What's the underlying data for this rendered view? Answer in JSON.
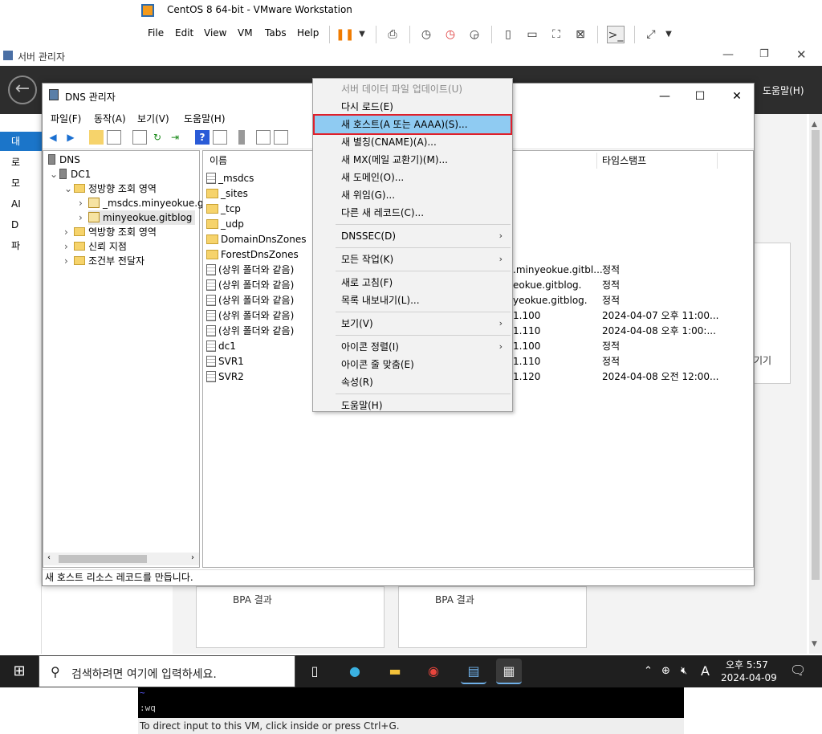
{
  "vm": {
    "title": "CentOS 8 64-bit - VMware Workstation",
    "menu": [
      "File",
      "Edit",
      "View",
      "VM",
      "Tabs",
      "Help"
    ],
    "status": "To direct input to this VM, click inside or press Ctrl+G.",
    "console_line1": "~",
    "console_line2": ":wq"
  },
  "server_manager": {
    "title": "서버 관리자",
    "help": "도움말(H)",
    "left_items": [
      "대",
      "로",
      "모",
      "AI",
      "D",
      "파"
    ],
    "bpa_label": "BPA 결과",
    "side_text": "기기"
  },
  "dns": {
    "title": "DNS 관리자",
    "menu": [
      "파일(F)",
      "동작(A)",
      "보기(V)",
      "도움말(H)"
    ],
    "status": "새 호스트 리소스 레코드를 만듭니다.",
    "tree": [
      {
        "label": "DNS",
        "kind": "root"
      },
      {
        "label": "DC1",
        "kind": "server"
      },
      {
        "label": "정방향 조회 영역",
        "kind": "folder"
      },
      {
        "label": "_msdcs.minyeokue.g",
        "kind": "zone"
      },
      {
        "label": "minyeokue.gitblog",
        "kind": "zone"
      },
      {
        "label": "역방향 조회 영역",
        "kind": "folder"
      },
      {
        "label": "신뢰 지점",
        "kind": "folder"
      },
      {
        "label": "조건부 전달자",
        "kind": "folder"
      }
    ],
    "columns": {
      "name": "이름",
      "timestamp": "타임스탬프"
    },
    "rows": [
      {
        "name": "_msdcs",
        "icon": "doc",
        "data": "",
        "ts": ""
      },
      {
        "name": "_sites",
        "icon": "folder",
        "data": "",
        "ts": ""
      },
      {
        "name": "_tcp",
        "icon": "folder",
        "data": "",
        "ts": ""
      },
      {
        "name": "_udp",
        "icon": "folder",
        "data": "",
        "ts": ""
      },
      {
        "name": "DomainDnsZones",
        "icon": "folder",
        "data": "",
        "ts": ""
      },
      {
        "name": "ForestDnsZones",
        "icon": "folder",
        "data": "",
        "ts": ""
      },
      {
        "name": "(상위 폴더와 같음)",
        "icon": "doc",
        "data": ".minyeokue.gitbl...",
        "ts": "정적"
      },
      {
        "name": "(상위 폴더와 같음)",
        "icon": "doc",
        "data": "eokue.gitblog.",
        "ts": "정적"
      },
      {
        "name": "(상위 폴더와 같음)",
        "icon": "doc",
        "data": "yeokue.gitblog.",
        "ts": "정적"
      },
      {
        "name": "(상위 폴더와 같음)",
        "icon": "doc",
        "data": "1.100",
        "ts": "2024-04-07 오후 11:00..."
      },
      {
        "name": "(상위 폴더와 같음)",
        "icon": "doc",
        "data": "1.110",
        "ts": "2024-04-08 오후 1:00:..."
      },
      {
        "name": "dc1",
        "icon": "doc",
        "data": "1.100",
        "ts": "정적"
      },
      {
        "name": "SVR1",
        "icon": "doc",
        "data": "1.110",
        "ts": "정적"
      },
      {
        "name": "SVR2",
        "icon": "doc",
        "data": "1.120",
        "ts": "2024-04-08 오전 12:00..."
      }
    ]
  },
  "context_menu": {
    "items": [
      {
        "label": "서버 데이터 파일 업데이트(U)",
        "disabled": true
      },
      {
        "label": "다시 로드(E)"
      },
      {
        "label": "새 호스트(A 또는 AAAA)(S)...",
        "highlight": true
      },
      {
        "label": "새 별칭(CNAME)(A)..."
      },
      {
        "label": "새 MX(메일 교환기)(M)..."
      },
      {
        "label": "새 도메인(O)..."
      },
      {
        "label": "새 위임(G)..."
      },
      {
        "label": "다른 새 레코드(C)..."
      },
      {
        "label": "DNSSEC(D)",
        "sub": true
      },
      {
        "label": "모든 작업(K)",
        "sub": true
      },
      {
        "label": "새로 고침(F)"
      },
      {
        "label": "목록 내보내기(L)..."
      },
      {
        "label": "보기(V)",
        "sub": true
      },
      {
        "label": "아이콘 정렬(I)",
        "sub": true
      },
      {
        "label": "아이콘 줄 맞춤(E)"
      },
      {
        "label": "속성(R)"
      },
      {
        "label": "도움말(H)"
      }
    ]
  },
  "taskbar": {
    "search_placeholder": "검색하려면 여기에 입력하세요.",
    "ime": "A",
    "time": "오후 5:57",
    "date": "2024-04-09"
  }
}
